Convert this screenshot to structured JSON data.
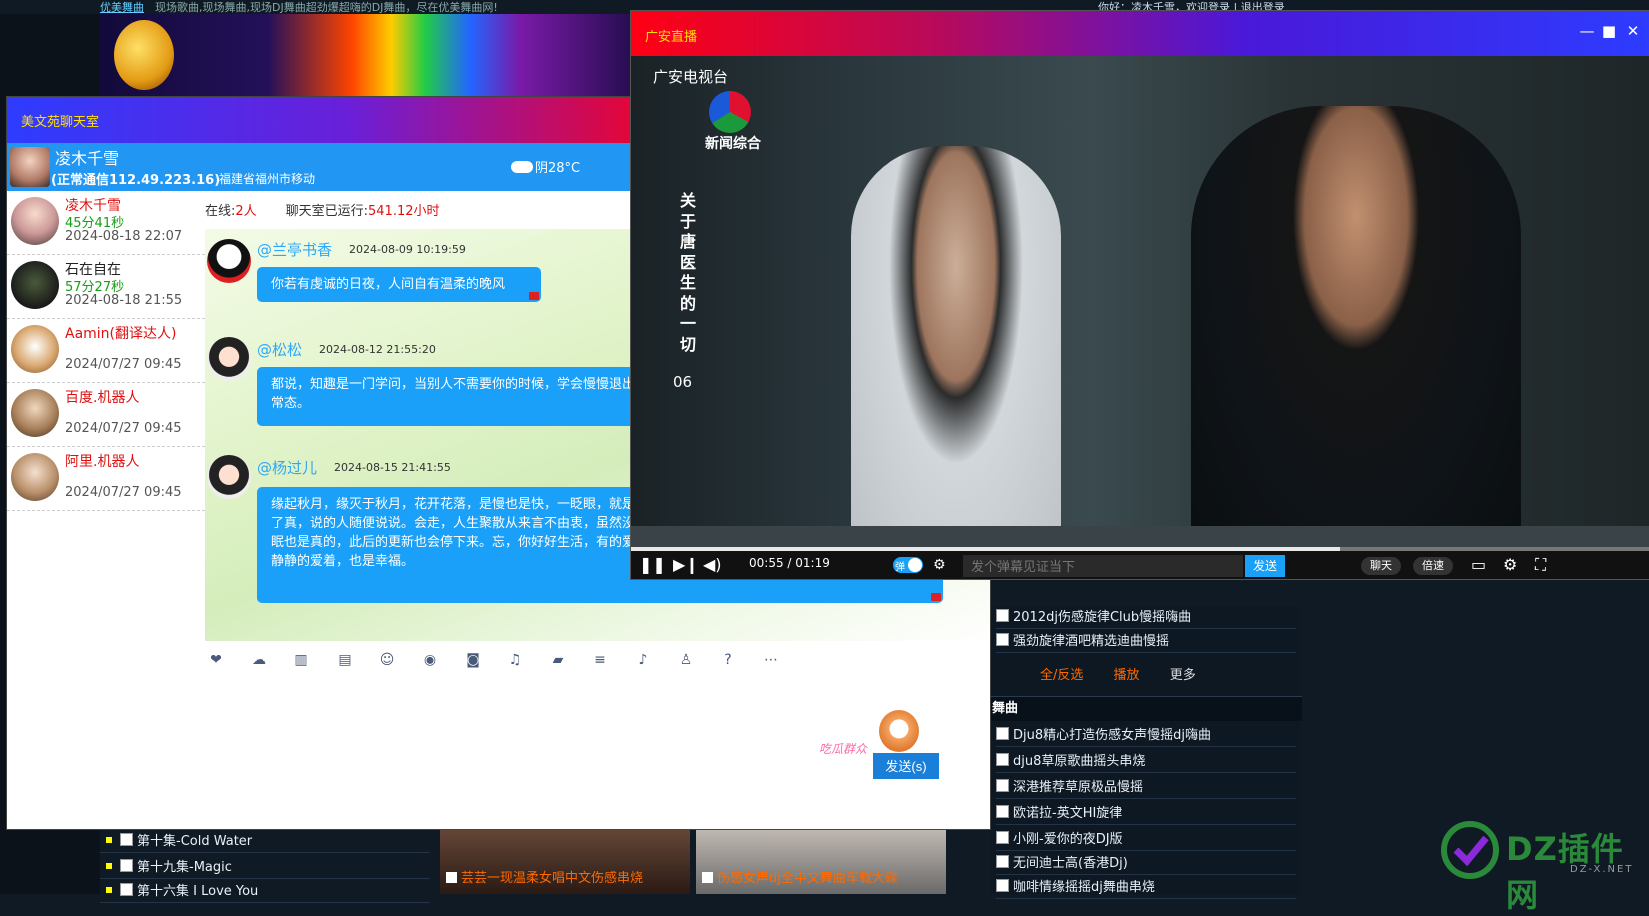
{
  "site": {
    "brand": "优美舞曲",
    "slogan": "现场歌曲,现场舞曲,现场DJ舞曲超劲爆超嗨的DJ舞曲，尽在优美舞曲网!",
    "login_text": "你好：凌木千雪，欢迎登录 | 退出登录",
    "right_list": [
      "2012dj伤感旋律Club慢摇嗨曲",
      "强劲旋律酒吧精选迪曲慢摇"
    ],
    "options": [
      "全/反选",
      "播放",
      "更多"
    ],
    "genre_heading": "舞曲",
    "genre_list": [
      "Dju8精心打造伤感女声慢摇dj嗨曲",
      "dju8草原歌曲摇头串烧",
      "深港推荐草原极品慢摇",
      "欧诺拉-英文HI旋律",
      "小刚-爱你的夜DJ版",
      "无间迪士高(香港Dj)",
      "咖啡情缘摇摇dj舞曲串烧"
    ],
    "bottom_left": [
      "第十集-Cold Water",
      "第十九集-Magic",
      "第十六集 I Love You"
    ],
    "thumbs": [
      "芸芸一现温柔女唱中文伤感串烧",
      "伤感女声dj全中文舞曲车载大碟"
    ],
    "dz_logo": "DZ插件网",
    "dz_sub": "DZ-X.NET"
  },
  "chat": {
    "title": "美文苑聊天室",
    "current_user": {
      "name": "凌木千雪",
      "connection": "(正常通信112.49.223.16)",
      "location": "福建省福州市移动",
      "weather": "阴28°C"
    },
    "users": [
      {
        "name": "凌木千雪",
        "online_time": "45分41秒",
        "date": "2024-08-18 22:07",
        "name_color": "#e01010"
      },
      {
        "name": "石在自在",
        "online_time": "57分27秒",
        "date": "2024-08-18 21:55",
        "name_color": "#222222"
      },
      {
        "name": "Aamin(翻译达人)",
        "online_time": "",
        "date": "2024/07/27 09:45",
        "name_color": "#e01010"
      },
      {
        "name": "百度.机器人",
        "online_time": "",
        "date": "2024/07/27 09:45",
        "name_color": "#e01010"
      },
      {
        "name": "阿里.机器人",
        "online_time": "",
        "date": "2024/07/27 09:45",
        "name_color": "#e01010"
      }
    ],
    "stats": {
      "online_label": "在线:",
      "online_count": "2人",
      "uptime_label": "聊天室已运行:",
      "uptime_value": "541.12小时"
    },
    "messages": [
      {
        "name": "@兰亭书香",
        "time": "2024-08-09 10:19:59",
        "text": "你若有虔诚的日夜，人间自有温柔的晚风"
      },
      {
        "name": "@松松",
        "time": "2024-08-12 21:55:20",
        "text": "都说，知趣是一门学问，当别人不需要你的时候，学会慢慢退出。怎会允许你游刃有余，忍不住才是常态，渐而失望也是常态。"
      },
      {
        "name": "@杨过儿",
        "time": "2024-08-15 21:41:55",
        "text": "缘起秋月，缘灭于秋月，花开花落，是慢也是快，一眨眼，就是一年。要随便许，有些话不要随便说，认真的人认了真，说的人随便说说。会走，人生聚散从来言不由衷，虽然没了像样的交代，对不起。是真的，哭过笑过彻夜难眠也是真的，此后的更新也会停下来。忘，你好好生活，有的爱不是要拥有，有的人不是一定要得到，越想看看，静静的爱着，也是幸福。"
      }
    ],
    "toolbar_icons": [
      "heart-icon",
      "cloud-icon",
      "map-icon",
      "card-icon",
      "smile-icon",
      "user-circle-icon",
      "camera-icon",
      "music-icon",
      "folder-icon",
      "list-icon",
      "bell-icon",
      "penguin-icon",
      "help-icon",
      "more-icon"
    ],
    "send_label": "发送(s)",
    "sticker_text": "吃瓜群众"
  },
  "video": {
    "title": "广安直播",
    "channel": "广安电视台",
    "channel_sub": "新闻综合",
    "show_title": "关于唐医生的一切",
    "episode": "06",
    "time": "00:55 / 01:19",
    "progress": 0.6962,
    "danmaku_toggle": "弹",
    "danmaku_placeholder": "发个弹幕见证当下",
    "danmaku_send": "发送",
    "chat_pill": "聊天",
    "speed_pill": "倍速"
  }
}
